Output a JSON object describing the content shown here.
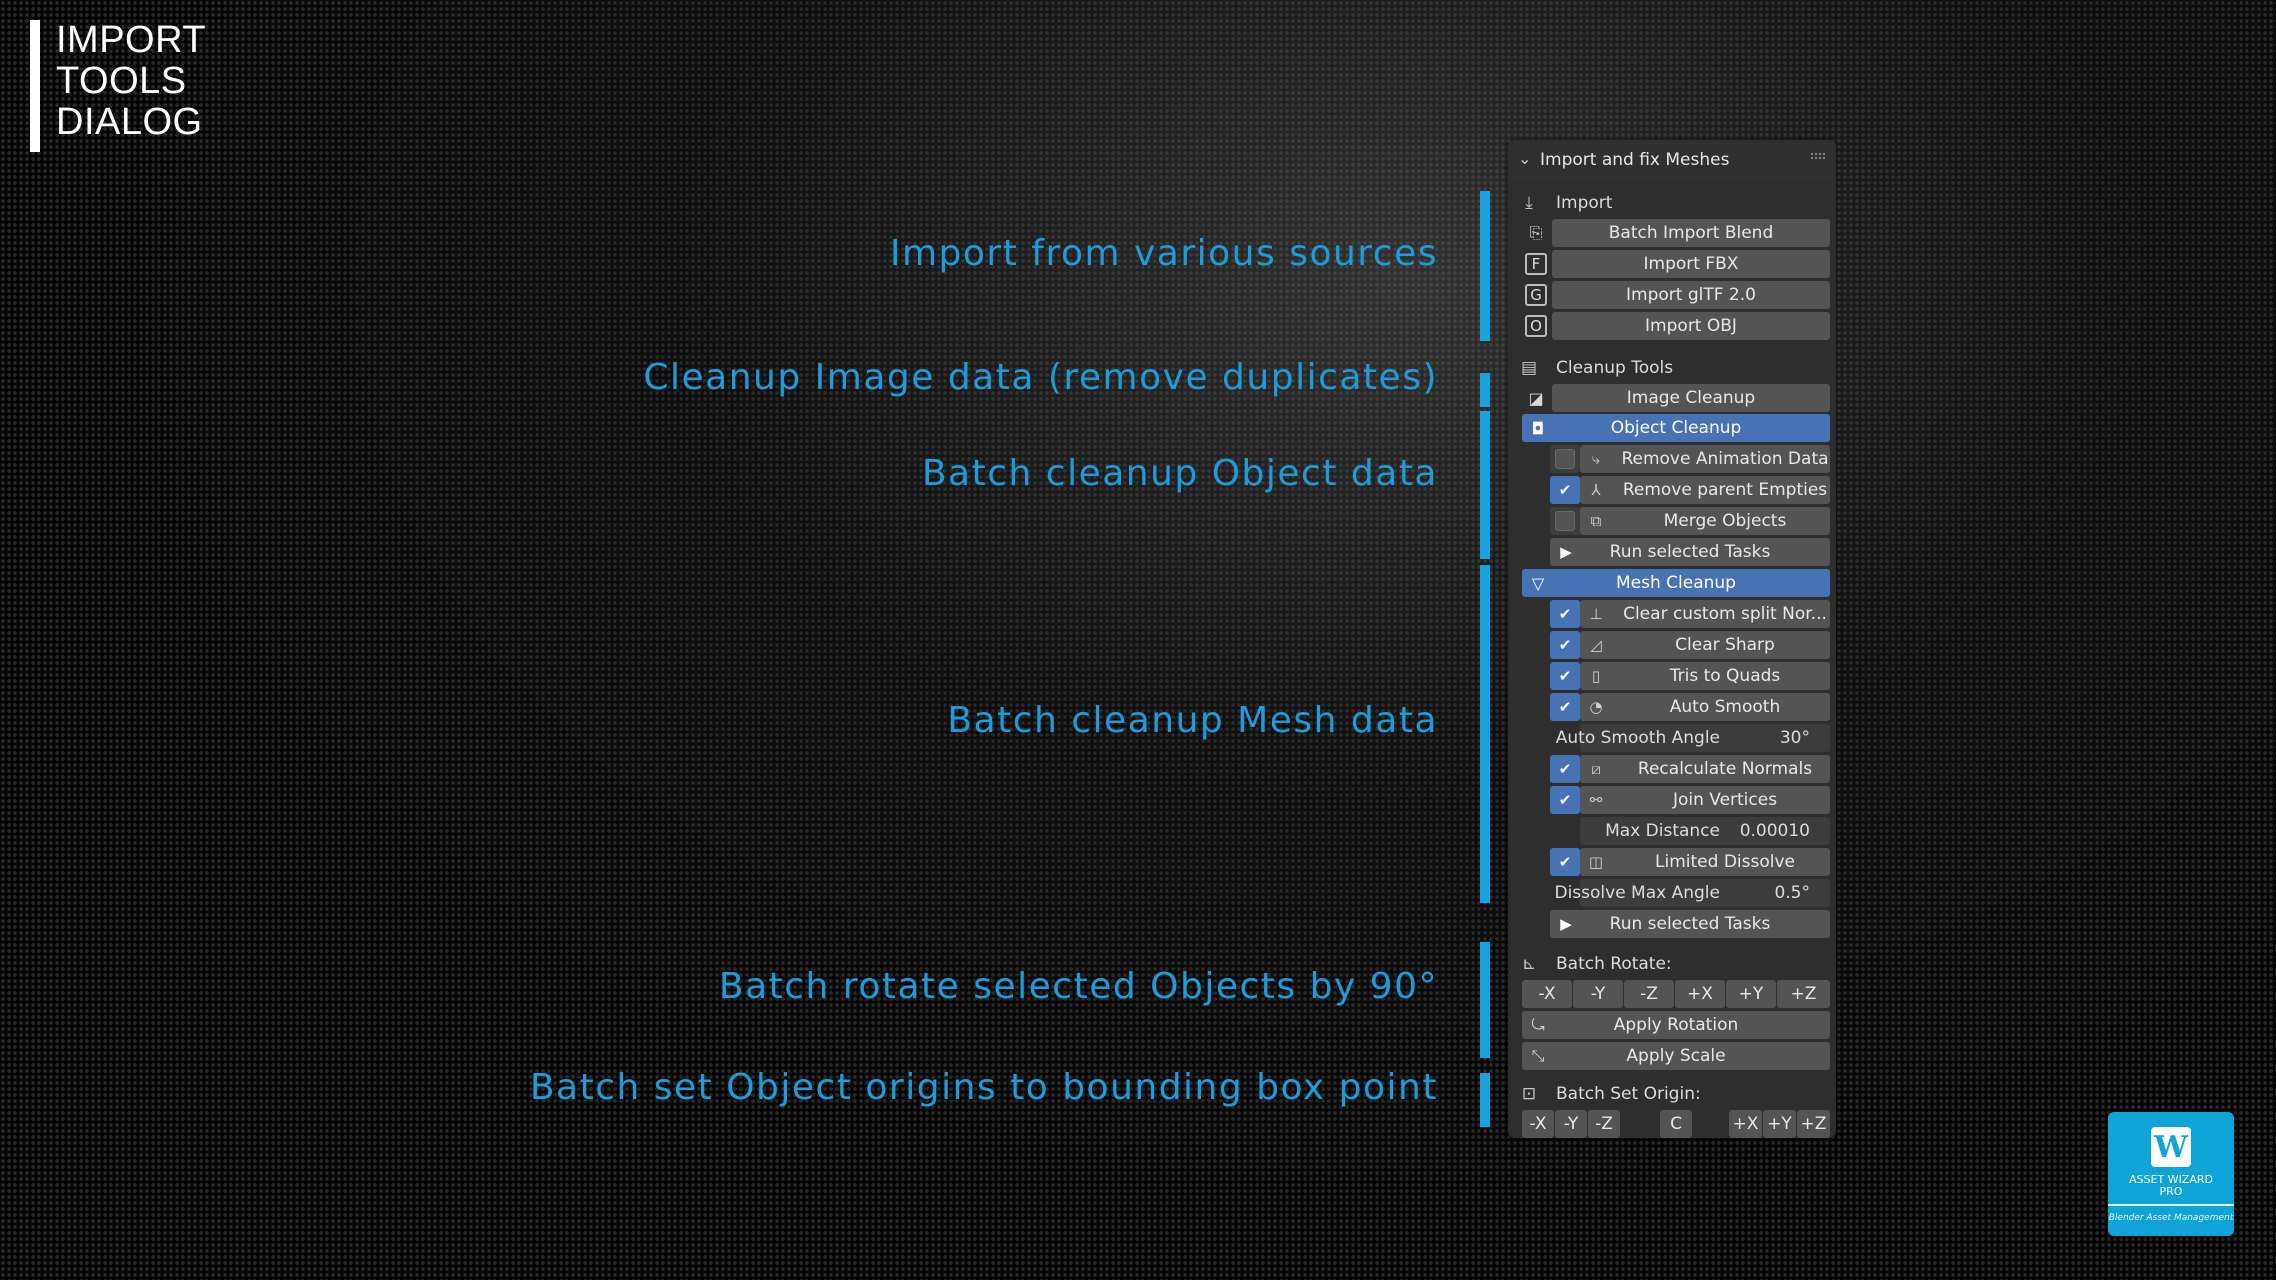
{
  "title_lines": [
    "IMPORT",
    "TOOLS",
    "DIALOG"
  ],
  "callouts": {
    "import": "Import from various sources",
    "image_cleanup": "Cleanup Image data (remove duplicates)",
    "object_cleanup": "Batch cleanup Object data",
    "mesh_cleanup": "Batch cleanup Mesh data",
    "rotate": "Batch rotate selected Objects by 90°",
    "origin": "Batch set Object origins to bounding box point"
  },
  "panel": {
    "title": "Import and fix Meshes",
    "import_section": "Import",
    "import_buttons": [
      "Batch Import Blend",
      "Import FBX",
      "Import glTF 2.0",
      "Import OBJ"
    ],
    "import_icon_letters": [
      "F",
      "G",
      "O"
    ],
    "cleanup_section": "Cleanup Tools",
    "image_cleanup": "Image Cleanup",
    "object_cleanup": "Object Cleanup",
    "object_tasks": [
      {
        "label": "Remove Animation Data",
        "checked": false
      },
      {
        "label": "Remove parent Empties",
        "checked": true
      },
      {
        "label": "Merge Objects",
        "checked": false
      }
    ],
    "run_selected": "Run selected Tasks",
    "mesh_cleanup": "Mesh Cleanup",
    "mesh_tasks": [
      {
        "label": "Clear custom split Nor...",
        "checked": true
      },
      {
        "label": "Clear Sharp",
        "checked": true
      },
      {
        "label": "Tris to Quads",
        "checked": true
      },
      {
        "label": "Auto Smooth",
        "checked": true
      }
    ],
    "auto_smooth_angle": {
      "label": "Auto Smooth Angle",
      "value": "30°"
    },
    "recalc_normals": "Recalculate Normals",
    "join_vertices": "Join Vertices",
    "max_distance": {
      "label": "Max Distance",
      "value": "0.00010"
    },
    "limited_dissolve": "Limited Dissolve",
    "dissolve_angle": {
      "label": "Dissolve Max Angle",
      "value": "0.5°"
    },
    "run_selected_mesh": "Run selected Tasks",
    "batch_rotate_label": "Batch Rotate:",
    "rotate_buttons": [
      "-X",
      "-Y",
      "-Z",
      "+X",
      "+Y",
      "+Z"
    ],
    "apply_rotation": "Apply Rotation",
    "apply_scale": "Apply Scale",
    "batch_origin_label": "Batch Set Origin:",
    "origin_buttons_left": [
      "-X",
      "-Y",
      "-Z"
    ],
    "origin_center": "C",
    "origin_buttons_right": [
      "+X",
      "+Y",
      "+Z"
    ]
  },
  "badge": {
    "logo_letter": "W",
    "line1": "ASSET WIZARD",
    "line2": "PRO",
    "line3": "Blender Asset Management"
  },
  "colors": {
    "accent": "#18a3dc",
    "selected": "#4772b3",
    "callout_text": "#1e9bd8"
  }
}
